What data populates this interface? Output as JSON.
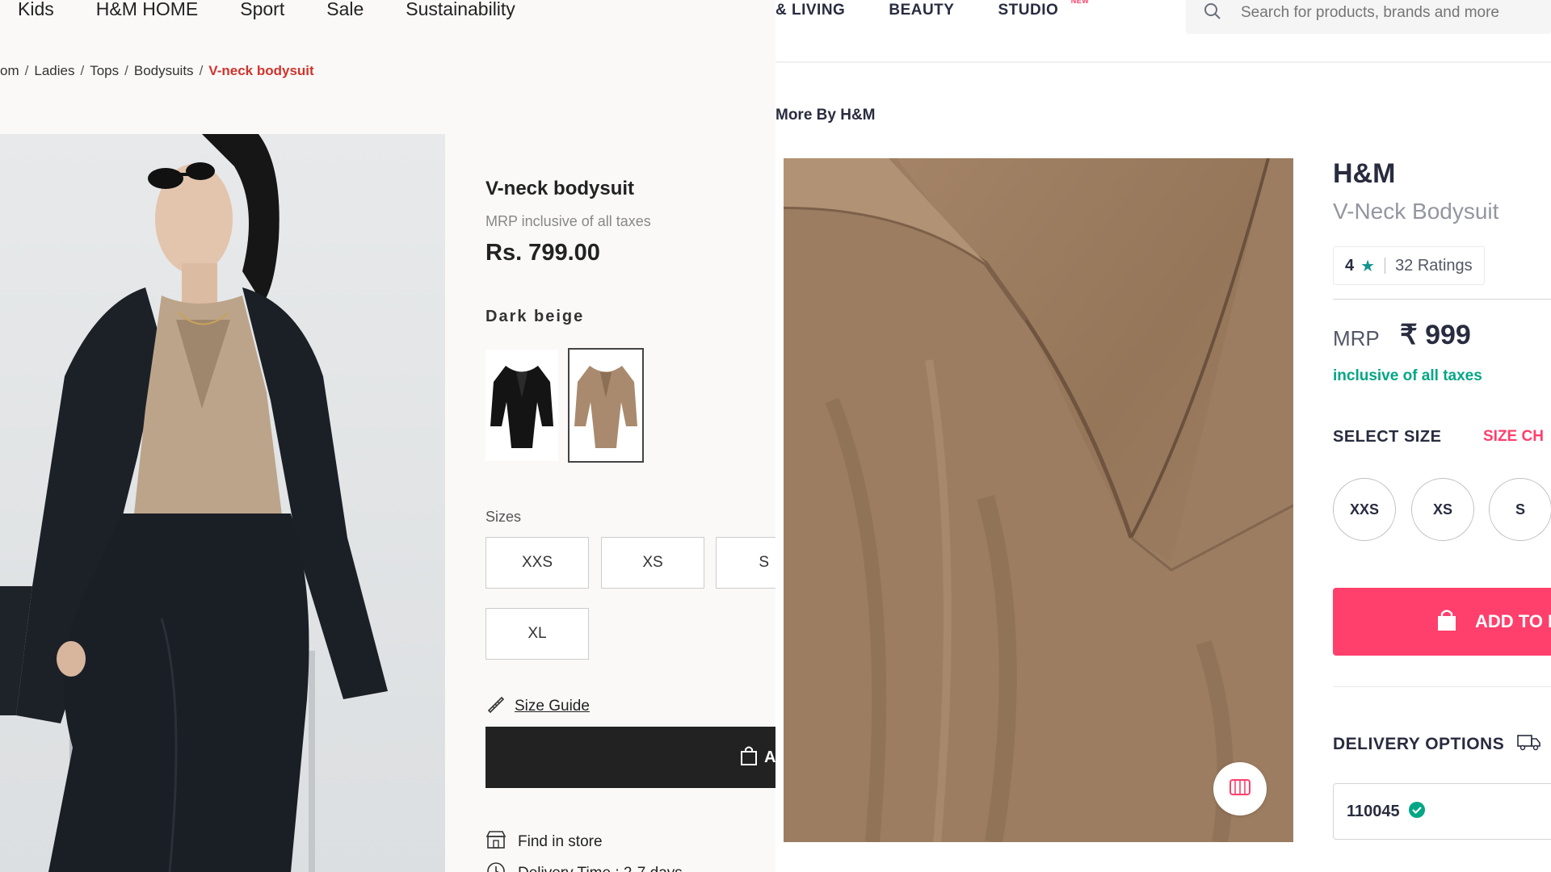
{
  "hm": {
    "nav": [
      "Kids",
      "H&M HOME",
      "Sport",
      "Sale",
      "Sustainability"
    ],
    "breadcrumb": [
      "om",
      "Ladies",
      "Tops",
      "Bodysuits",
      "V-neck bodysuit"
    ],
    "product": {
      "title": "V-neck bodysuit",
      "mrp_note": "MRP inclusive of all taxes",
      "price": "Rs. 799.00",
      "color": "Dark beige",
      "sizes_label": "Sizes",
      "sizes": [
        "XXS",
        "XS",
        "S",
        "XL"
      ],
      "size_guide": "Size Guide",
      "add_label": "A",
      "find_in_store": "Find in store",
      "delivery_time": "Delivery Time : 2-7 days"
    },
    "colors": {
      "accent": "#d0342c",
      "button": "#222222"
    }
  },
  "myntra": {
    "nav": [
      "& LIVING",
      "BEAUTY",
      "STUDIO"
    ],
    "studio_badge": "NEW",
    "search_placeholder": "Search for products, brands and more",
    "breadcrumb": "More By H&M",
    "brand": "H&M",
    "product_name": "V-Neck Bodysuit",
    "rating": {
      "value": "4",
      "star": "★",
      "count": "32 Ratings"
    },
    "mrp_label": "MRP",
    "price": "₹ 999",
    "tax_note": "inclusive of all taxes",
    "select_size": "SELECT SIZE",
    "size_chart": "SIZE CH",
    "sizes": [
      "XXS",
      "XS",
      "S"
    ],
    "add_to_bag": "ADD TO B",
    "delivery_options": "DELIVERY OPTIONS",
    "pincode": "110045",
    "colors": {
      "accent": "#ff3f6c",
      "green": "#03a685",
      "star": "#14958f"
    }
  }
}
